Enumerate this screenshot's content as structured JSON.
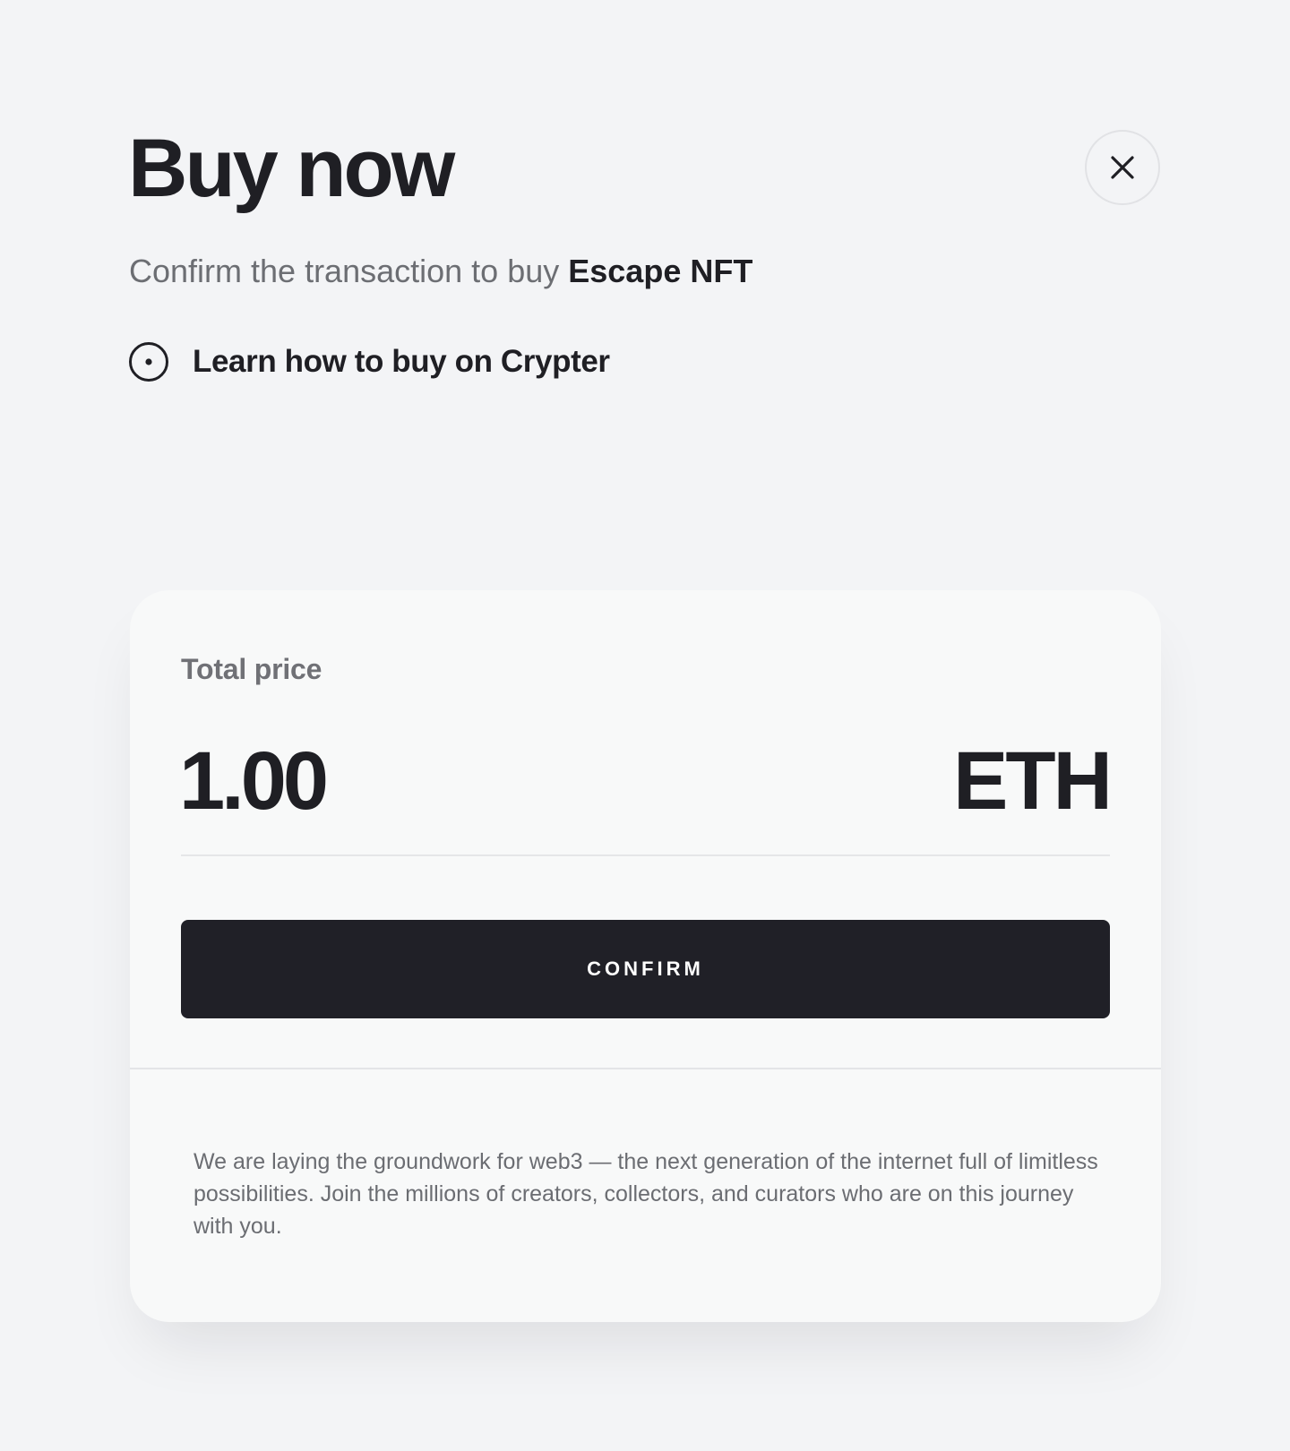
{
  "header": {
    "title": "Buy now",
    "close_icon": "close-icon"
  },
  "subtitle": {
    "prefix": "Confirm the transaction to buy ",
    "item_name": "Escape NFT"
  },
  "learn_link": {
    "icon": "circle-dot-icon",
    "label": "Learn how to buy on Crypter"
  },
  "price": {
    "label": "Total price",
    "value": "1.00",
    "currency": "ETH"
  },
  "confirm": {
    "label": "CONFIRM"
  },
  "footer": {
    "text": "We are laying the groundwork for web3 — the next generation of the internet full of limitless possibilities. Join the millions of creators, collectors, and curators who are on this journey with you."
  },
  "colors": {
    "background": "#f3f4f6",
    "card": "#f8f9f9",
    "text_primary": "#1f1f24",
    "text_secondary": "#6c6e73",
    "button": "#202027"
  }
}
